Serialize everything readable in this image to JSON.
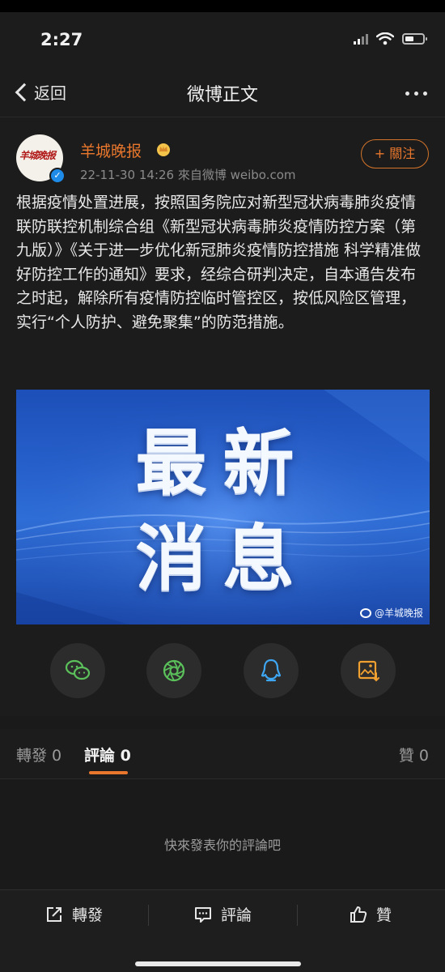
{
  "status_bar": {
    "time": "2:27"
  },
  "nav": {
    "back_label": "返回",
    "title": "微博正文"
  },
  "post": {
    "author": "羊城晚报",
    "avatar_text": "羊城晚报",
    "meta": "22-11-30 14:26  來自微博 weibo.com",
    "follow_label": "+ 關注",
    "body": "根据疫情处置进展，按照国务院应对新型冠状病毒肺炎疫情联防联控机制综合组《新型冠状病毒肺炎疫情防控方案（第九版）》《关于进一步优化新冠肺炎疫情防控措施 科学精准做好防控工作的通知》要求，经综合研判决定，自本通告发布之时起，解除所有疫情防控临时管控区，按低风险区管理，实行“个人防护、避免聚集”的防范措施。",
    "image": {
      "headline_line1": "最新",
      "headline_line2": "消息",
      "watermark": "@羊城晚报"
    }
  },
  "share_icons": [
    "wechat-icon",
    "moments-icon",
    "qq-icon",
    "save-image-icon"
  ],
  "tabs": {
    "repost": "轉發 0",
    "comment": "評論 0",
    "like": "贊 0"
  },
  "comments": {
    "empty_message": "快來發表你的評論吧"
  },
  "bottom_bar": {
    "repost": "轉發",
    "comment": "評論",
    "like": "贊"
  },
  "colors": {
    "accent": "#e8772d",
    "background": "#1c1c1c",
    "verified": "#1e8be8",
    "image_blue": "#2761cc"
  }
}
